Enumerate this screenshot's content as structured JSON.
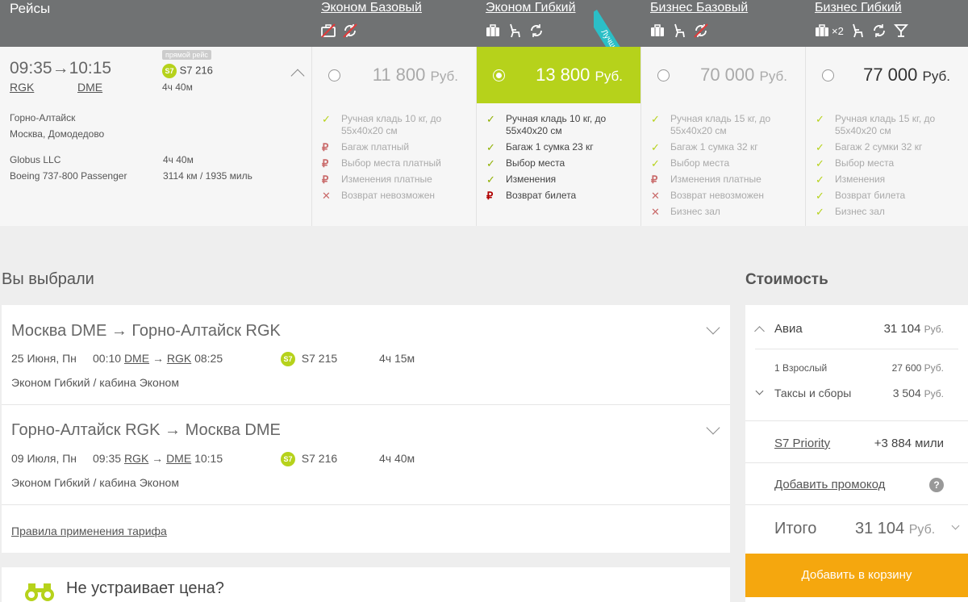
{
  "header": {
    "title": "Рейсы",
    "fares": [
      {
        "name": "Эконом Базовый",
        "icons": [
          "crossed-bag-icon",
          "crossed-change-icon"
        ]
      },
      {
        "name": "Эконом Гибкий",
        "icons": [
          "bag-icon",
          "seat-icon",
          "change-icon"
        ],
        "ribbon": "Лучший!"
      },
      {
        "name": "Бизнес Базовый",
        "icons": [
          "bag-icon",
          "seat-icon",
          "crossed-change-icon"
        ]
      },
      {
        "name": "Бизнес Гибкий",
        "icons": [
          "bag-icon",
          "seat-icon",
          "change-icon",
          "cocktail-icon"
        ],
        "bag_count": "×2"
      }
    ]
  },
  "flight": {
    "dep_time": "09:35",
    "arr_time": "10:15",
    "dep_code": "RGK",
    "arr_code": "DME",
    "badge": "прямой рейс",
    "airline_logo": "S7",
    "flight_no": "S7 216",
    "duration": "4ч 40м",
    "from_city": "Горно-Алтайск",
    "to_city": "Москва, Домодедово",
    "operator": "Globus LLC",
    "duration2": "4ч 40м",
    "aircraft": "Boeing 737-800 Passenger",
    "distance": "3114 км / 1935 миль"
  },
  "fares": [
    {
      "amount": "11 800",
      "currency": "Руб.",
      "features": [
        {
          "mark": "ok",
          "text": "Ручная кладь 10 кг, до 55х40х20 см"
        },
        {
          "mark": "rub",
          "text": "Багаж платный"
        },
        {
          "mark": "rub",
          "text": "Выбор места платный"
        },
        {
          "mark": "rub",
          "text": "Изменения платные"
        },
        {
          "mark": "no",
          "text": "Возврат невозможен"
        }
      ]
    },
    {
      "amount": "13 800",
      "currency": "Руб.",
      "features": [
        {
          "mark": "ok",
          "text": "Ручная кладь 10 кг, до 55х40х20 см"
        },
        {
          "mark": "ok",
          "text": "Багаж 1 сумка 23 кг"
        },
        {
          "mark": "ok",
          "text": "Выбор места"
        },
        {
          "mark": "ok",
          "text": "Изменения"
        },
        {
          "mark": "rub",
          "text": "Возврат билета"
        }
      ]
    },
    {
      "amount": "70 000",
      "currency": "Руб.",
      "features": [
        {
          "mark": "ok",
          "text": "Ручная кладь 15 кг, до 55х40х20 см"
        },
        {
          "mark": "ok",
          "text": "Багаж 1 сумка 32 кг"
        },
        {
          "mark": "ok",
          "text": "Выбор места"
        },
        {
          "mark": "rub",
          "text": "Изменения платные"
        },
        {
          "mark": "no",
          "text": "Возврат невозможен"
        },
        {
          "mark": "no",
          "text": "Бизнес зал"
        }
      ]
    },
    {
      "amount": "77 000",
      "currency": "Руб.",
      "features": [
        {
          "mark": "ok",
          "text": "Ручная кладь 15 кг, до 55х40х20 см"
        },
        {
          "mark": "ok",
          "text": "Багаж 2 сумки 32 кг"
        },
        {
          "mark": "ok",
          "text": "Выбор места"
        },
        {
          "mark": "ok",
          "text": "Изменения"
        },
        {
          "mark": "ok",
          "text": "Возврат билета"
        },
        {
          "mark": "ok",
          "text": "Бизнес зал"
        }
      ]
    }
  ],
  "selected": {
    "title": "Вы выбрали",
    "segments": [
      {
        "route": "Москва DME → Горно-Алтайск RGK",
        "date": "25 Июня, Пн",
        "dep_time": "00:10",
        "dep_code": "DME",
        "arr_code": "RGK",
        "arr_time": "08:25",
        "logo": "S7",
        "flight_no": "S7 215",
        "duration": "4ч 15м",
        "cabin": "Эконом Гибкий / кабина Эконом"
      },
      {
        "route": "Горно-Алтайск RGK → Москва DME",
        "date": "09 Июля, Пн",
        "dep_time": "09:35",
        "dep_code": "RGK",
        "arr_code": "DME",
        "arr_time": "10:15",
        "logo": "S7",
        "flight_no": "S7 216",
        "duration": "4ч 40м",
        "cabin": "Эконом Гибкий / кабина Эконом"
      }
    ],
    "rules_link": "Правила применения тарифа"
  },
  "price_prompt": "Не устраивает цена?",
  "cost": {
    "title": "Стоимость",
    "avia_label": "Авиа",
    "avia_amount": "31 104",
    "currency": "Руб.",
    "adult_label": "1 Взрослый",
    "adult_amount": "27 600",
    "taxes_label": "Таксы и сборы",
    "taxes_amount": "3 504",
    "priority_label": "S7 Priority",
    "priority_miles": "+3 884 мили",
    "promo_link": "Добавить промокод",
    "help": "?",
    "total_label": "Итого",
    "total_amount": "31 104",
    "cart_button": "Добавить в корзину"
  }
}
